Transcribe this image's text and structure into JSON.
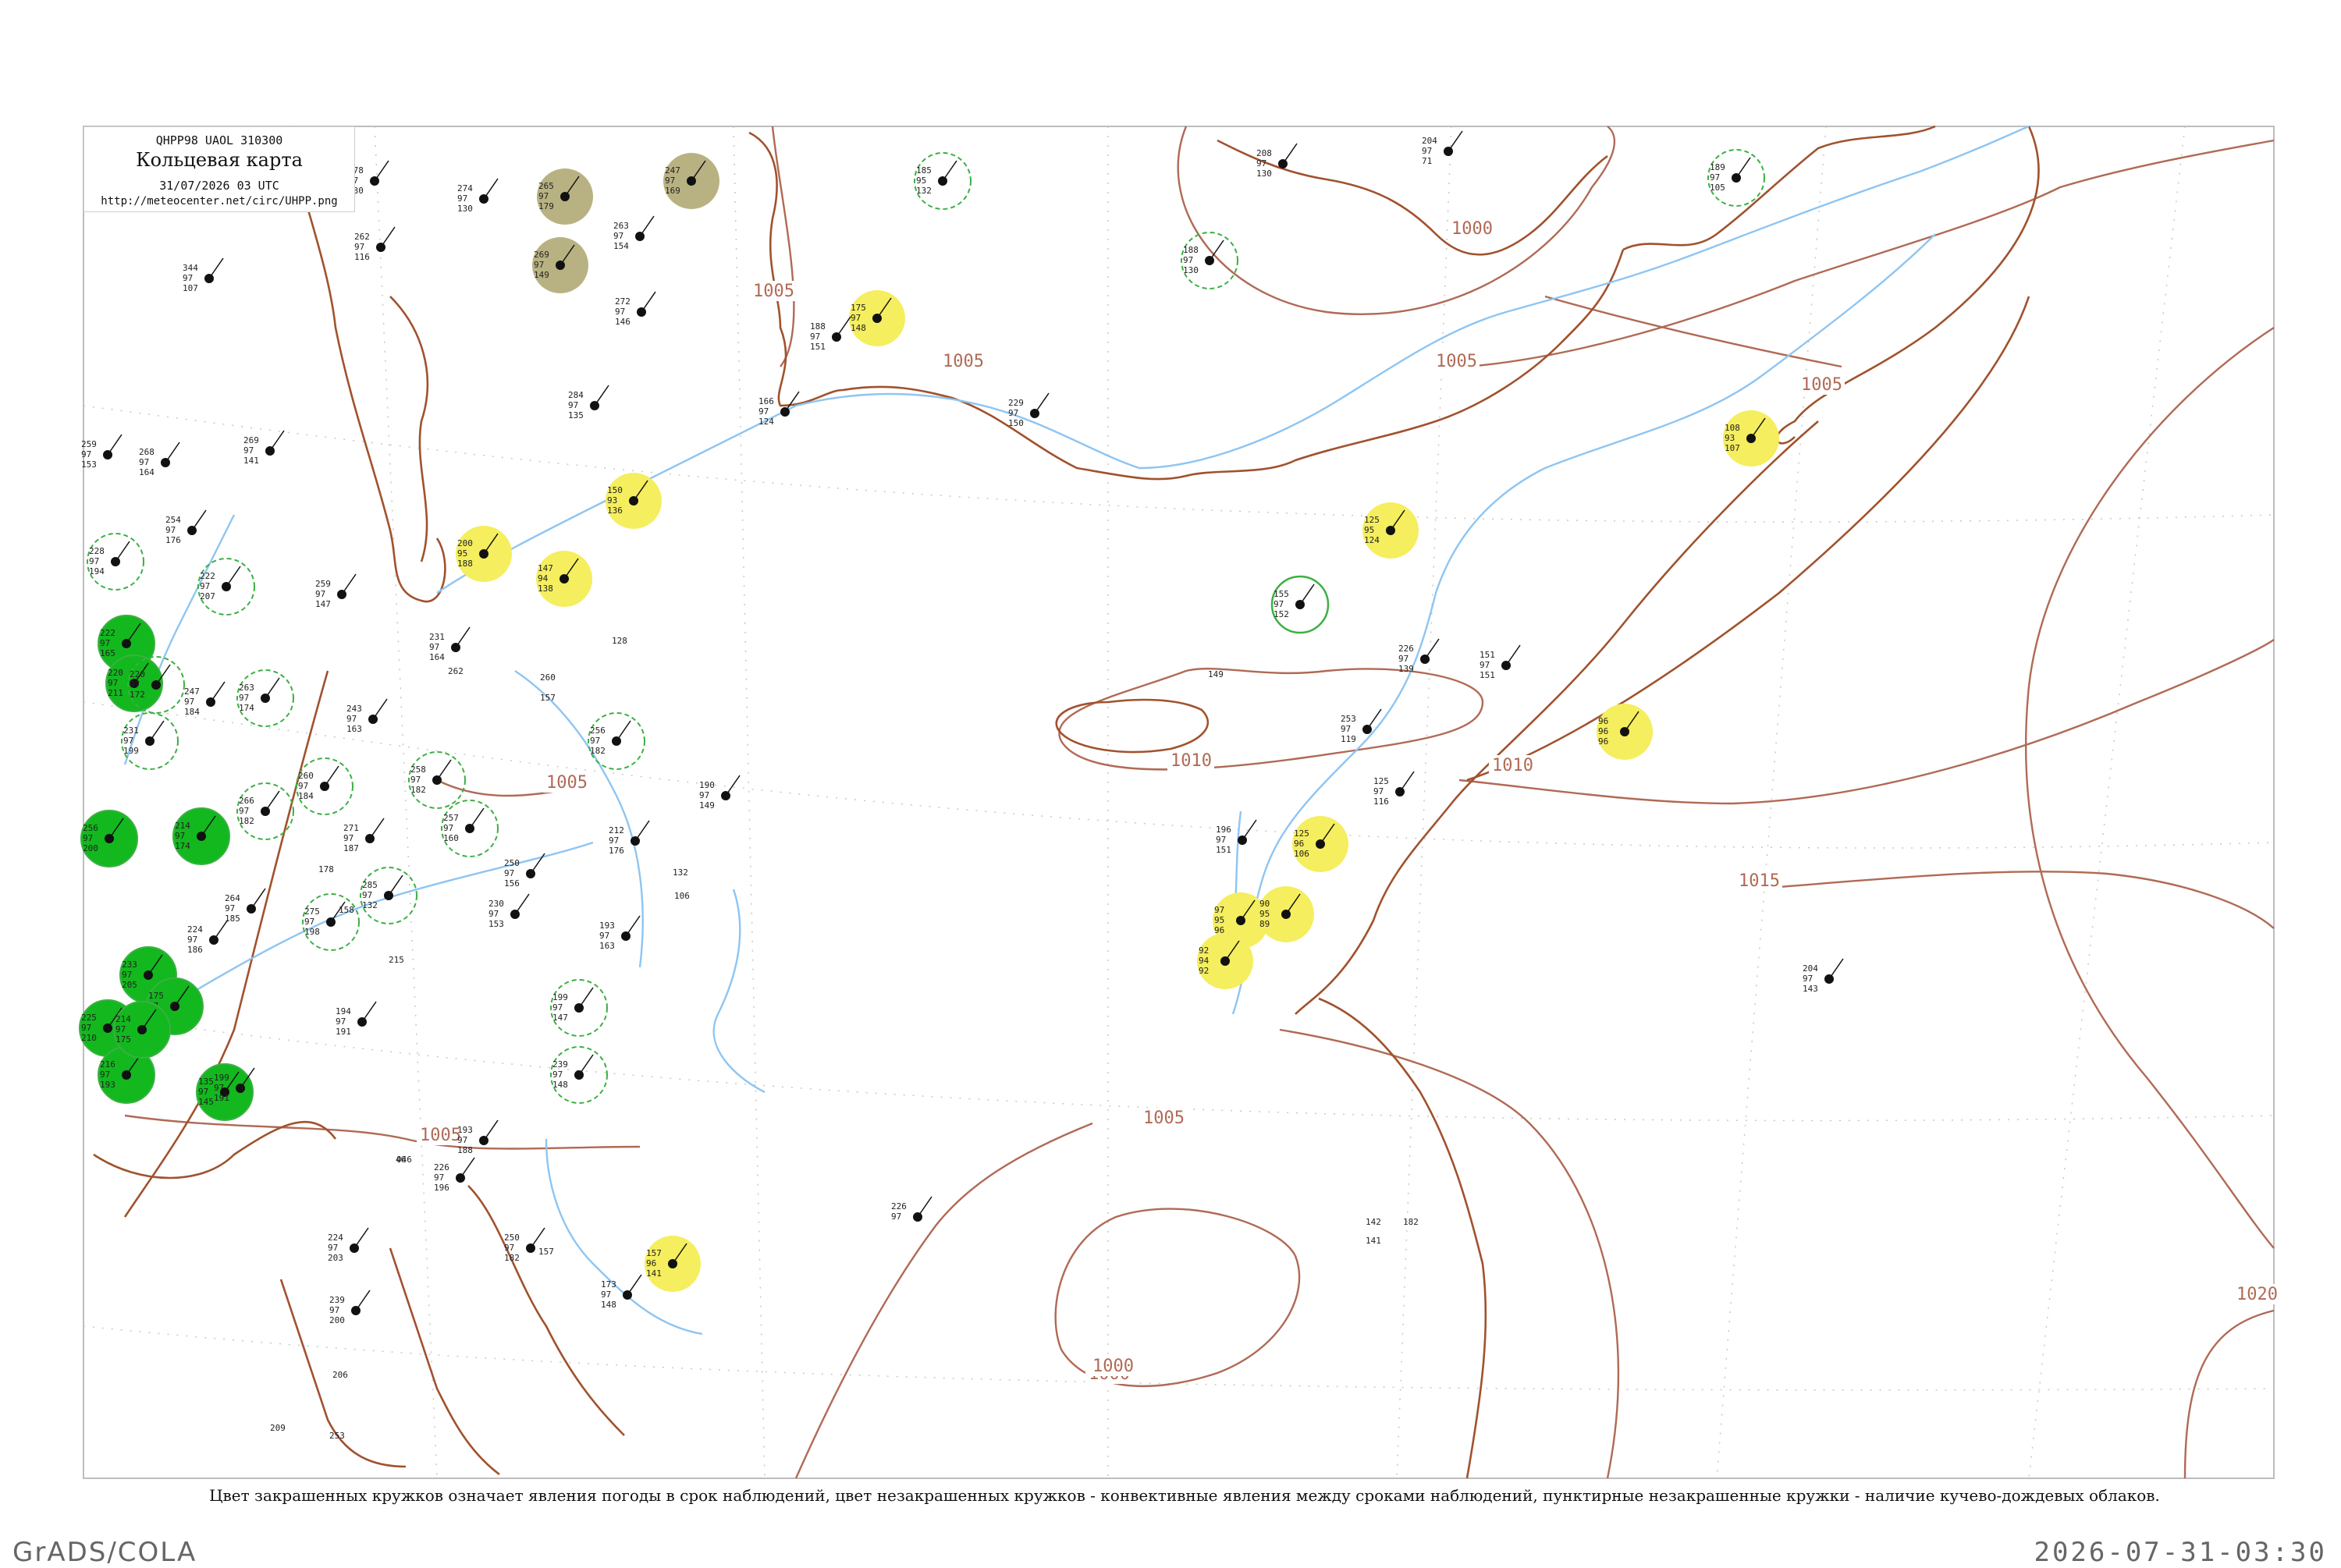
{
  "header": {
    "product_code": "QHPP98  UAOL  310300",
    "title": "Кольцевая карта",
    "datetime": "31/07/2026 03 UTC",
    "url": "http://meteocenter.net/circ/UHPP.png"
  },
  "caption": "Цвет закрашенных кружков означает явления погоды в срок наблюдений, цвет незакрашенных кружков - конвективные явления между сроками наблюдений, пунктирные незакрашенные кружки - наличие кучево-дождевых облаков.",
  "footer": {
    "software": "GrADS/COLA",
    "timestamp": "2026-07-31-03:30"
  },
  "colors": {
    "coast": "#a0522d",
    "river": "#8ec5f2",
    "isobar": "#b06a55",
    "fill_green": "#12b81e",
    "fill_yellow": "#f5ee5e",
    "fill_olive": "#b8b283",
    "ring_green": "#3cb043"
  },
  "isobar_labels": [
    "1000",
    "1000",
    "1005",
    "1005",
    "1005",
    "1005",
    "1005",
    "1005",
    "1010",
    "1010",
    "1015",
    "1020",
    "1005",
    "1000"
  ],
  "stations": [
    {
      "kind": "green-fill",
      "nums": [
        "222",
        "97",
        "165"
      ]
    },
    {
      "kind": "green-fill",
      "nums": [
        "220",
        "97",
        "211"
      ]
    },
    {
      "kind": "green-fill",
      "nums": [
        "256",
        "97",
        "200"
      ]
    },
    {
      "kind": "green-fill",
      "nums": [
        "225",
        "97",
        "210"
      ]
    },
    {
      "kind": "green-fill",
      "nums": [
        "216",
        "97",
        "193"
      ]
    },
    {
      "kind": "green-fill",
      "nums": [
        "233",
        "97",
        "205"
      ]
    },
    {
      "kind": "green-fill",
      "nums": [
        "175",
        "97",
        "215"
      ]
    },
    {
      "kind": "green-fill",
      "nums": [
        "214",
        "97",
        "174"
      ]
    },
    {
      "kind": "green-fill",
      "nums": [
        "214",
        "97",
        "175"
      ]
    },
    {
      "kind": "green-fill",
      "nums": [
        "135",
        "97",
        "145"
      ]
    },
    {
      "kind": "yellow-fill",
      "nums": [
        "150",
        "93",
        "136"
      ]
    },
    {
      "kind": "yellow-fill",
      "nums": [
        "200",
        "95",
        "188"
      ]
    },
    {
      "kind": "yellow-fill",
      "nums": [
        "147",
        "94",
        "138"
      ]
    },
    {
      "kind": "yellow-fill",
      "nums": [
        "175",
        "97",
        "148"
      ]
    },
    {
      "kind": "yellow-fill",
      "nums": [
        "108",
        "93",
        "107"
      ]
    },
    {
      "kind": "yellow-fill",
      "nums": [
        "125",
        "95",
        "124"
      ]
    },
    {
      "kind": "yellow-fill",
      "nums": [
        "96",
        "96",
        "96"
      ]
    },
    {
      "kind": "yellow-fill",
      "nums": [
        "125",
        "96",
        "106"
      ]
    },
    {
      "kind": "yellow-fill",
      "nums": [
        "97",
        "95",
        "96"
      ]
    },
    {
      "kind": "yellow-fill",
      "nums": [
        "90",
        "95",
        "89"
      ]
    },
    {
      "kind": "yellow-fill",
      "nums": [
        "92",
        "94",
        "92"
      ]
    },
    {
      "kind": "yellow-fill",
      "nums": [
        "157",
        "96",
        "141"
      ]
    },
    {
      "kind": "olive-fill",
      "nums": [
        "265",
        "97",
        "179"
      ]
    },
    {
      "kind": "olive-fill",
      "nums": [
        "269",
        "97",
        "149"
      ]
    },
    {
      "kind": "olive-fill",
      "nums": [
        "247",
        "97",
        "169"
      ]
    },
    {
      "kind": "dashed-ring",
      "nums": [
        "185",
        "95",
        "132"
      ]
    },
    {
      "kind": "dashed-ring",
      "nums": [
        "188",
        "97",
        "130"
      ]
    },
    {
      "kind": "dashed-ring",
      "nums": [
        "189",
        "97",
        "105"
      ]
    },
    {
      "kind": "dashed-ring",
      "nums": [
        "228",
        "97",
        "194"
      ]
    },
    {
      "kind": "dashed-ring",
      "nums": [
        "222",
        "97",
        "207"
      ]
    },
    {
      "kind": "dashed-ring",
      "nums": [
        "220",
        "97",
        "172"
      ]
    },
    {
      "kind": "dashed-ring",
      "nums": [
        "231",
        "97",
        "199"
      ]
    },
    {
      "kind": "dashed-ring",
      "nums": [
        "263",
        "97",
        "174"
      ]
    },
    {
      "kind": "dashed-ring",
      "nums": [
        "260",
        "97",
        "184"
      ]
    },
    {
      "kind": "dashed-ring",
      "nums": [
        "266",
        "97",
        "182"
      ]
    },
    {
      "kind": "dashed-ring",
      "nums": [
        "275",
        "97",
        "198"
      ]
    },
    {
      "kind": "dashed-ring",
      "nums": [
        "285",
        "97",
        "132"
      ]
    },
    {
      "kind": "dashed-ring",
      "nums": [
        "258",
        "97",
        "182"
      ]
    },
    {
      "kind": "dashed-ring",
      "nums": [
        "257",
        "97",
        "160"
      ]
    },
    {
      "kind": "dashed-ring",
      "nums": [
        "256",
        "97",
        "182"
      ]
    },
    {
      "kind": "dashed-ring",
      "nums": [
        "199",
        "97",
        "147"
      ]
    },
    {
      "kind": "dashed-ring",
      "nums": [
        "239",
        "97",
        "148"
      ]
    },
    {
      "kind": "solid-ring",
      "nums": [
        "155",
        "97",
        "152"
      ]
    },
    {
      "kind": "plain",
      "nums": [
        "278",
        "97",
        "130"
      ]
    },
    {
      "kind": "plain",
      "nums": [
        "274",
        "97",
        "130"
      ]
    },
    {
      "kind": "plain",
      "nums": [
        "262",
        "97",
        "116"
      ]
    },
    {
      "kind": "plain",
      "nums": [
        "344",
        "97",
        "107"
      ]
    },
    {
      "kind": "plain",
      "nums": [
        "263",
        "97",
        "154"
      ]
    },
    {
      "kind": "plain",
      "nums": [
        "272",
        "97",
        "146"
      ]
    },
    {
      "kind": "plain",
      "nums": [
        "188",
        "97",
        "151"
      ]
    },
    {
      "kind": "plain",
      "nums": [
        "284",
        "97",
        "135"
      ]
    },
    {
      "kind": "plain",
      "nums": [
        "269",
        "97",
        "141"
      ]
    },
    {
      "kind": "plain",
      "nums": [
        "259",
        "97",
        "153"
      ]
    },
    {
      "kind": "plain",
      "nums": [
        "268",
        "97",
        "164"
      ]
    },
    {
      "kind": "plain",
      "nums": [
        "254",
        "97",
        "176"
      ]
    },
    {
      "kind": "plain",
      "nums": [
        "208",
        "97",
        "130"
      ]
    },
    {
      "kind": "plain",
      "nums": [
        "204",
        "97",
        "71"
      ]
    },
    {
      "kind": "plain",
      "nums": [
        "166",
        "97",
        "124"
      ]
    },
    {
      "kind": "plain",
      "nums": [
        "229",
        "97",
        "150"
      ]
    },
    {
      "kind": "plain",
      "nums": [
        "226",
        "97",
        "139"
      ]
    },
    {
      "kind": "plain",
      "nums": [
        "151",
        "97",
        "151"
      ]
    },
    {
      "kind": "plain",
      "nums": [
        "253",
        "97",
        "119"
      ]
    },
    {
      "kind": "plain",
      "nums": [
        "125",
        "97",
        "116"
      ]
    },
    {
      "kind": "plain",
      "nums": [
        "196",
        "97",
        "151"
      ]
    },
    {
      "kind": "plain",
      "nums": [
        "204",
        "97",
        "143"
      ]
    },
    {
      "kind": "plain",
      "nums": [
        "226",
        "97"
      ]
    },
    {
      "kind": "plain",
      "nums": [
        "190",
        "97",
        "149"
      ]
    },
    {
      "kind": "plain",
      "nums": [
        "212",
        "97",
        "176"
      ]
    },
    {
      "kind": "plain",
      "nums": [
        "193",
        "97",
        "163"
      ]
    },
    {
      "kind": "plain",
      "nums": [
        "250",
        "97",
        "156"
      ]
    },
    {
      "kind": "plain",
      "nums": [
        "230",
        "97",
        "153"
      ]
    },
    {
      "kind": "plain",
      "nums": [
        "194",
        "97",
        "191"
      ]
    },
    {
      "kind": "plain",
      "nums": [
        "199",
        "97",
        "191"
      ]
    },
    {
      "kind": "plain",
      "nums": [
        "224",
        "97",
        "186"
      ]
    },
    {
      "kind": "plain",
      "nums": [
        "264",
        "97",
        "185"
      ]
    },
    {
      "kind": "plain",
      "nums": [
        "271",
        "97",
        "187"
      ]
    },
    {
      "kind": "plain",
      "nums": [
        "243",
        "97",
        "163"
      ]
    },
    {
      "kind": "plain",
      "nums": [
        "247",
        "97",
        "184"
      ]
    },
    {
      "kind": "plain",
      "nums": [
        "259",
        "97",
        "147"
      ]
    },
    {
      "kind": "plain",
      "nums": [
        "231",
        "97",
        "164"
      ]
    },
    {
      "kind": "plain",
      "nums": [
        "193",
        "97",
        "188"
      ]
    },
    {
      "kind": "plain",
      "nums": [
        "226",
        "97",
        "196"
      ]
    },
    {
      "kind": "plain",
      "nums": [
        "224",
        "97",
        "203"
      ]
    },
    {
      "kind": "plain",
      "nums": [
        "239",
        "97",
        "200"
      ]
    },
    {
      "kind": "plain",
      "nums": [
        "173",
        "97",
        "148"
      ]
    },
    {
      "kind": "plain",
      "nums": [
        "250",
        "97",
        "182"
      ]
    }
  ],
  "lone_values": [
    "046",
    "149",
    "142",
    "182",
    "141",
    "157",
    "128",
    "260",
    "157",
    "132",
    "106",
    "158",
    "215",
    "262",
    "178",
    "46",
    "209",
    "253",
    "206"
  ]
}
